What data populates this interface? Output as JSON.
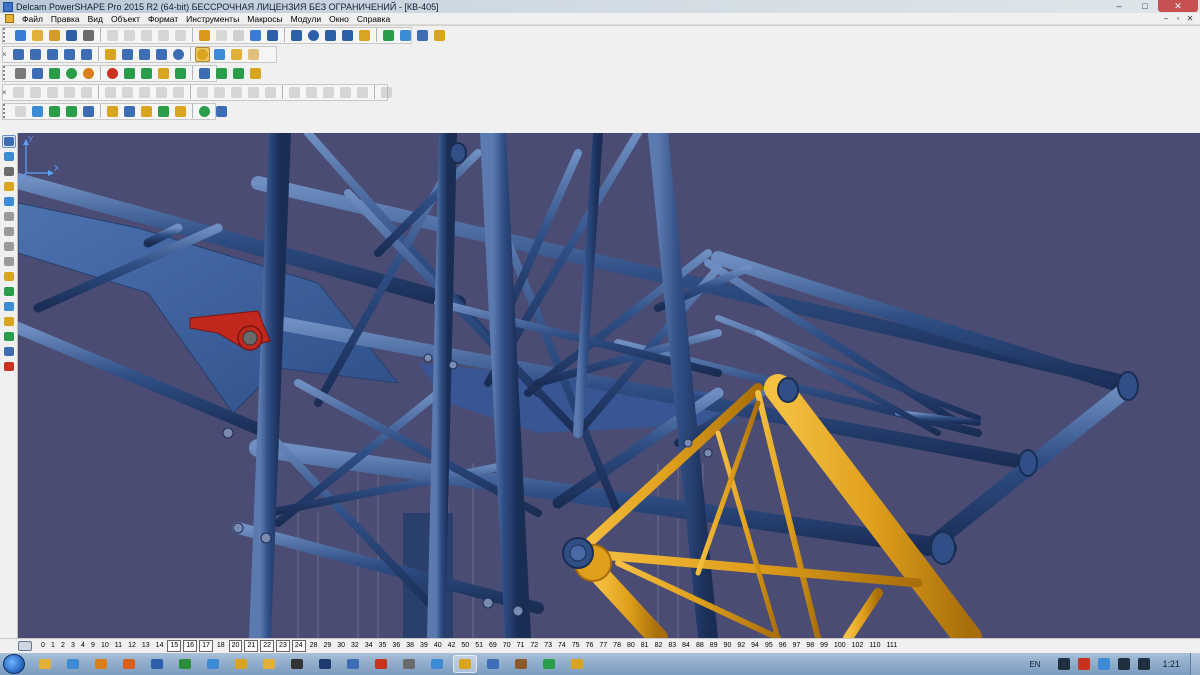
{
  "window": {
    "title": "Delcam PowerSHAPE Pro 2015 R2 (64-bit) БЕССРОЧНАЯ ЛИЦЕНЗИЯ БЕЗ ОГРАНИЧЕНИЙ - [КВ-405]",
    "buttons": {
      "minimize": "–",
      "maximize": "□",
      "close": "✕"
    }
  },
  "menu": {
    "items": [
      "Файл",
      "Правка",
      "Вид",
      "Объект",
      "Формат",
      "Инструменты",
      "Макросы",
      "Модули",
      "Окно",
      "Справка"
    ],
    "mdi_buttons": {
      "minimize": "–",
      "restore": "▫",
      "close": "✕"
    }
  },
  "toolbar_close_glyph": "×",
  "toolbars": {
    "row1": [
      {
        "icon": "new-model-icon",
        "color": "#3a7bd5"
      },
      {
        "icon": "open-icon",
        "color": "#e0b13a"
      },
      {
        "icon": "open-folder-icon",
        "color": "#d59b2a"
      },
      {
        "icon": "save-icon",
        "color": "#2d5fa8"
      },
      {
        "icon": "print-icon",
        "color": "#6b6b6b"
      },
      {
        "icon": "cut-icon",
        "color": "#9a9a9a",
        "disabled": true
      },
      {
        "icon": "copy-icon",
        "color": "#9a9a9a",
        "disabled": true
      },
      {
        "icon": "paste-icon",
        "color": "#9a9a9a",
        "disabled": true
      },
      {
        "icon": "erase-icon",
        "color": "#9a9a9a",
        "disabled": true
      },
      {
        "icon": "delete-icon",
        "color": "#9a9a9a",
        "disabled": true
      },
      {
        "icon": "undo-icon",
        "color": "#d99a1a"
      },
      {
        "icon": "redo-icon",
        "color": "#a0a0a0",
        "disabled": true
      },
      {
        "icon": "help-pointer-icon",
        "color": "#8c8c8c",
        "disabled": true
      },
      {
        "icon": "select-icon",
        "color": "#3a7bd5"
      },
      {
        "icon": "workplane-icon",
        "color": "#2d5fa8"
      },
      {
        "icon": "line-icon",
        "color": "#2d5fa8"
      },
      {
        "icon": "circle-icon",
        "color": "#2d5fa8",
        "round": true
      },
      {
        "icon": "curve-icon",
        "color": "#2d5fa8"
      },
      {
        "icon": "text-icon",
        "color": "#2d5fa8"
      },
      {
        "icon": "surface-icon",
        "color": "#d9a520"
      },
      {
        "icon": "solid-icon",
        "color": "#2a9d4a"
      },
      {
        "icon": "assembly-icon",
        "color": "#3d8bd5"
      },
      {
        "icon": "mesh-icon",
        "color": "#3d6db5"
      },
      {
        "icon": "tools-icon",
        "color": "#d9a520"
      }
    ],
    "row2": [
      {
        "icon": "view-top-icon",
        "color": "#3d6db5"
      },
      {
        "icon": "view-front-icon",
        "color": "#3d6db5"
      },
      {
        "icon": "view-side-icon",
        "color": "#3d6db5"
      },
      {
        "icon": "view-iso-icon",
        "color": "#3d6db5"
      },
      {
        "icon": "view-rotate-icon",
        "color": "#3d6db5"
      },
      {
        "icon": "zoom-fit-icon",
        "color": "#d9a520"
      },
      {
        "icon": "zoom-in-icon",
        "color": "#3d6db5"
      },
      {
        "icon": "zoom-out-icon",
        "color": "#3d6db5"
      },
      {
        "icon": "zoom-box-icon",
        "color": "#3d6db5"
      },
      {
        "icon": "globe-icon",
        "color": "#3d6db5",
        "round": true
      },
      {
        "icon": "shaded-icon",
        "color": "#d9a520",
        "on": true,
        "round": true
      },
      {
        "icon": "wireframe-icon",
        "color": "#3d8bd5"
      },
      {
        "icon": "light-icon",
        "color": "#e0b13a"
      },
      {
        "icon": "hand-icon",
        "color": "#e0c07a"
      }
    ],
    "row3": [
      {
        "icon": "calculator-icon",
        "color": "#7a7a7a"
      },
      {
        "icon": "document-icon",
        "color": "#3d6db5"
      },
      {
        "icon": "layers-icon",
        "color": "#2a9d4a"
      },
      {
        "icon": "sphere-icon",
        "color": "#2a9d4a",
        "round": true
      },
      {
        "icon": "ball-orange-icon",
        "color": "#d9801a",
        "round": true
      },
      {
        "icon": "ball-red-icon",
        "color": "#c8321e",
        "round": true
      },
      {
        "icon": "play-icon",
        "color": "#2a9d4a"
      },
      {
        "icon": "arrow-green-icon",
        "color": "#2a9d4a"
      },
      {
        "icon": "cube-icon",
        "color": "#d9a520"
      },
      {
        "icon": "cubes-icon",
        "color": "#2a9d4a"
      },
      {
        "icon": "box-stack-icon",
        "color": "#3d6db5"
      },
      {
        "icon": "convert-icon",
        "color": "#2a9d4a"
      },
      {
        "icon": "diamond-icon",
        "color": "#2a9d4a"
      },
      {
        "icon": "component-icon",
        "color": "#d9a520"
      }
    ],
    "row4": [
      {
        "icon": "solid-select-icon",
        "color": "#9a9a9a",
        "disabled": true
      },
      {
        "icon": "flag-icon",
        "color": "#9a9a9a",
        "disabled": true
      },
      {
        "icon": "feature-icon",
        "color": "#9a9a9a",
        "disabled": true
      },
      {
        "icon": "solid-box-icon",
        "color": "#9a9a9a",
        "disabled": true
      },
      {
        "icon": "solid-cyl-icon",
        "color": "#9a9a9a",
        "disabled": true
      },
      {
        "icon": "extrude-icon",
        "color": "#9a9a9a",
        "disabled": true
      },
      {
        "icon": "revolve-icon",
        "color": "#9a9a9a",
        "disabled": true
      },
      {
        "icon": "fillet-icon",
        "color": "#9a9a9a",
        "disabled": true
      },
      {
        "icon": "chamfer-icon",
        "color": "#9a9a9a",
        "disabled": true
      },
      {
        "icon": "shell-icon",
        "color": "#9a9a9a",
        "disabled": true
      },
      {
        "icon": "boolean-icon",
        "color": "#9a9a9a",
        "disabled": true
      },
      {
        "icon": "cut-solid-icon",
        "color": "#9a9a9a",
        "disabled": true
      },
      {
        "icon": "pattern-icon",
        "color": "#9a9a9a",
        "disabled": true
      },
      {
        "icon": "mirror-icon",
        "color": "#9a9a9a",
        "disabled": true
      },
      {
        "icon": "draft-icon",
        "color": "#9a9a9a",
        "disabled": true
      },
      {
        "icon": "split-icon",
        "color": "#9a9a9a",
        "disabled": true
      },
      {
        "icon": "tree-icon",
        "color": "#9a9a9a",
        "disabled": true
      },
      {
        "icon": "history-icon",
        "color": "#9a9a9a",
        "disabled": true
      },
      {
        "icon": "link-icon",
        "color": "#9a9a9a",
        "disabled": true
      },
      {
        "icon": "replay-icon",
        "color": "#9a9a9a",
        "disabled": true
      },
      {
        "icon": "settings-icon",
        "color": "#9a9a9a",
        "disabled": true
      }
    ],
    "row5": [
      {
        "icon": "mesh-select-icon",
        "color": "#9a9a9a",
        "disabled": true
      },
      {
        "icon": "pointer-xy-icon",
        "color": "#3d8bd5"
      },
      {
        "icon": "mesh-cube-icon",
        "color": "#2a9d4a"
      },
      {
        "icon": "mesh-green-icon",
        "color": "#2a9d4a"
      },
      {
        "icon": "mesh-join-icon",
        "color": "#3d6db5"
      },
      {
        "icon": "mesh-split-icon",
        "color": "#d9a520"
      },
      {
        "icon": "mesh-smooth-icon",
        "color": "#3d6db5"
      },
      {
        "icon": "mesh-repair-icon",
        "color": "#d9a520"
      },
      {
        "icon": "mesh-grid-icon",
        "color": "#2a9d4a"
      },
      {
        "icon": "mesh-scale-icon",
        "color": "#d9a520"
      },
      {
        "icon": "mesh-color-icon",
        "color": "#2a9d4a",
        "round": true
      },
      {
        "icon": "mesh-shade-icon",
        "color": "#3d6db5"
      }
    ]
  },
  "left_toolbar": [
    {
      "icon": "select-arrow-icon",
      "color": "#3d6db5",
      "selected": true
    },
    {
      "icon": "quick-select-icon",
      "color": "#3d8bd5"
    },
    {
      "icon": "intelligent-cursor-icon",
      "color": "#6b6b6b"
    },
    {
      "icon": "warning-icon",
      "color": "#d9a520"
    },
    {
      "icon": "snap-icon",
      "color": "#3d8bd5"
    },
    {
      "icon": "grid-snap-icon",
      "color": "#9a9a9a"
    },
    {
      "icon": "workplane-snap-icon",
      "color": "#9a9a9a"
    },
    {
      "icon": "move-icon",
      "color": "#9a9a9a"
    },
    {
      "icon": "rotate-icon",
      "color": "#9a9a9a"
    },
    {
      "icon": "scale-icon",
      "color": "#d9a520"
    },
    {
      "icon": "mirror-tool-icon",
      "color": "#2a9d4a"
    },
    {
      "icon": "edit-icon",
      "color": "#3d8bd5"
    },
    {
      "icon": "offset-icon",
      "color": "#d9a520"
    },
    {
      "icon": "blend-icon",
      "color": "#2a9d4a"
    },
    {
      "icon": "limit-icon",
      "color": "#3d6db5"
    },
    {
      "icon": "stop-icon",
      "color": "#c8321e"
    }
  ],
  "viewport": {
    "background": "#4b4c73",
    "steel_blue": "#2f4f86",
    "steel_highlight": "#6f8fc2",
    "steel_dark": "#1e3460",
    "plate_blue": "#3f63a0",
    "yellow_boom": "#e0a01c",
    "yellow_dark": "#a86e0a",
    "red_part": "#c0281e",
    "axis_labels": {
      "y": "Y",
      "x": "X"
    },
    "axis_color": "#5aa0ff"
  },
  "levels": [
    {
      "n": "0"
    },
    {
      "n": "1"
    },
    {
      "n": "2"
    },
    {
      "n": "3"
    },
    {
      "n": "4"
    },
    {
      "n": "9"
    },
    {
      "n": "10"
    },
    {
      "n": "11"
    },
    {
      "n": "12"
    },
    {
      "n": "13"
    },
    {
      "n": "14"
    },
    {
      "n": "15",
      "boxed": true
    },
    {
      "n": "16",
      "boxed": true
    },
    {
      "n": "17",
      "boxed": true
    },
    {
      "n": "18"
    },
    {
      "n": "20",
      "boxed": true
    },
    {
      "n": "21",
      "boxed": true
    },
    {
      "n": "22",
      "boxed": true
    },
    {
      "n": "23",
      "boxed": true
    },
    {
      "n": "24",
      "boxed": true
    },
    {
      "n": "28"
    },
    {
      "n": "29"
    },
    {
      "n": "30"
    },
    {
      "n": "32"
    },
    {
      "n": "34"
    },
    {
      "n": "35"
    },
    {
      "n": "36"
    },
    {
      "n": "38"
    },
    {
      "n": "39"
    },
    {
      "n": "40"
    },
    {
      "n": "42"
    },
    {
      "n": "50"
    },
    {
      "n": "51"
    },
    {
      "n": "69"
    },
    {
      "n": "70"
    },
    {
      "n": "71"
    },
    {
      "n": "72"
    },
    {
      "n": "73"
    },
    {
      "n": "74"
    },
    {
      "n": "75"
    },
    {
      "n": "76"
    },
    {
      "n": "77"
    },
    {
      "n": "78"
    },
    {
      "n": "80"
    },
    {
      "n": "81"
    },
    {
      "n": "82"
    },
    {
      "n": "83"
    },
    {
      "n": "84"
    },
    {
      "n": "88"
    },
    {
      "n": "89"
    },
    {
      "n": "90"
    },
    {
      "n": "92"
    },
    {
      "n": "94"
    },
    {
      "n": "95"
    },
    {
      "n": "96"
    },
    {
      "n": "97"
    },
    {
      "n": "98"
    },
    {
      "n": "99"
    },
    {
      "n": "100"
    },
    {
      "n": "102"
    },
    {
      "n": "110"
    },
    {
      "n": "111"
    }
  ],
  "taskbar": {
    "apps": [
      {
        "icon": "explorer-icon",
        "color": "#e0b13a"
      },
      {
        "icon": "ie-icon",
        "color": "#3d8bd5"
      },
      {
        "icon": "media-icon",
        "color": "#d9801a"
      },
      {
        "icon": "firefox-icon",
        "color": "#d9601a"
      },
      {
        "icon": "word-icon",
        "color": "#2d5fa8"
      },
      {
        "icon": "excel-icon",
        "color": "#2a8d3a"
      },
      {
        "icon": "paint-icon",
        "color": "#3d8bd5"
      },
      {
        "icon": "powershape-icon",
        "color": "#d9a520"
      },
      {
        "icon": "folder-icon",
        "color": "#e0b13a"
      },
      {
        "icon": "terminal-icon",
        "color": "#333333"
      },
      {
        "icon": "photoshop-icon",
        "color": "#1f3a70"
      },
      {
        "icon": "disk-icon",
        "color": "#3d6db5"
      },
      {
        "icon": "camera-icon",
        "color": "#c8321e"
      },
      {
        "icon": "viewer-icon",
        "color": "#6b6b6b"
      },
      {
        "icon": "cad-icon",
        "color": "#3d8bd5"
      },
      {
        "icon": "powershape-2-icon",
        "color": "#d9a520",
        "active": true
      },
      {
        "icon": "network-icon",
        "color": "#3d6db5"
      },
      {
        "icon": "archive-icon",
        "color": "#8c5a2a"
      },
      {
        "icon": "chat-icon",
        "color": "#2a9d4a"
      },
      {
        "icon": "powershape-3-icon",
        "color": "#d9a520"
      }
    ],
    "language": "EN",
    "clock": "1:21",
    "tray": [
      {
        "icon": "arrow-up-icon",
        "color": "#203040"
      },
      {
        "icon": "security-icon",
        "color": "#c8321e"
      },
      {
        "icon": "update-icon",
        "color": "#3d8bd5"
      },
      {
        "icon": "network-tray-icon",
        "color": "#203040"
      },
      {
        "icon": "volume-icon",
        "color": "#203040"
      }
    ]
  }
}
